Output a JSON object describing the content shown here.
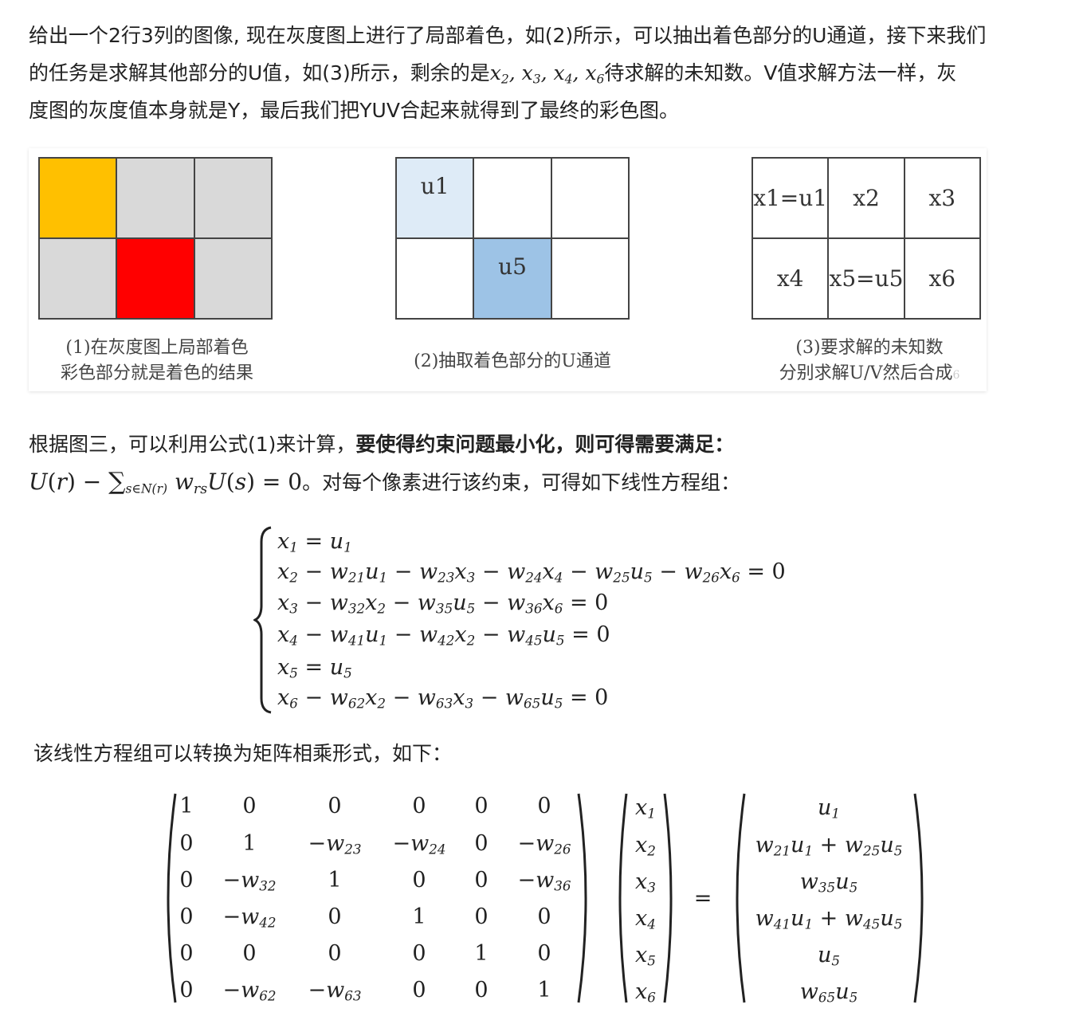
{
  "para1": {
    "line1": "给出一个2行3列的图像, 现在灰度图上进行了局部着色，如(2)所示，可以抽出着色部分的U通道，接下来我们",
    "line2_a": "的任务是求解其他部分的U值，如(3)所示，剩余的是",
    "line2_b": "待求解的未知数。V值求解方法一样，灰",
    "line3": "度图的灰度值本身就是Y，最后我们把YUV合起来就得到了最终的彩色图。"
  },
  "figure": {
    "colors": {
      "orange": "#FFC000",
      "red": "#FF0000",
      "gray": "#D9D9D9",
      "light_blue": "#DEEBF7",
      "blue": "#9DC3E6"
    },
    "grid2": {
      "u1": "u1",
      "u5": "u5"
    },
    "grid3": [
      "x1=u1",
      "x2",
      "x3",
      "x4",
      "x5=u5",
      "x6"
    ],
    "caption1_line1": "(1)在灰度图上局部着色",
    "caption1_line2": "彩色部分就是着色的结果",
    "caption2": "(2)抽取着色部分的U通道",
    "caption3_line1": "(3)要求解的未知数",
    "caption3_line2": "分别求解U/V然后合成",
    "watermark": "6"
  },
  "para2": {
    "text_a": "根据图三，可以利用公式(1)来计算，",
    "text_bold": "要使得约束问题最小化，则可得需要满足：",
    "formula_tail": "。对每个像素进行该约束，可得如下线性方程组："
  },
  "para3": "该线性方程组可以转换为矩阵相乘形式，如下："
}
